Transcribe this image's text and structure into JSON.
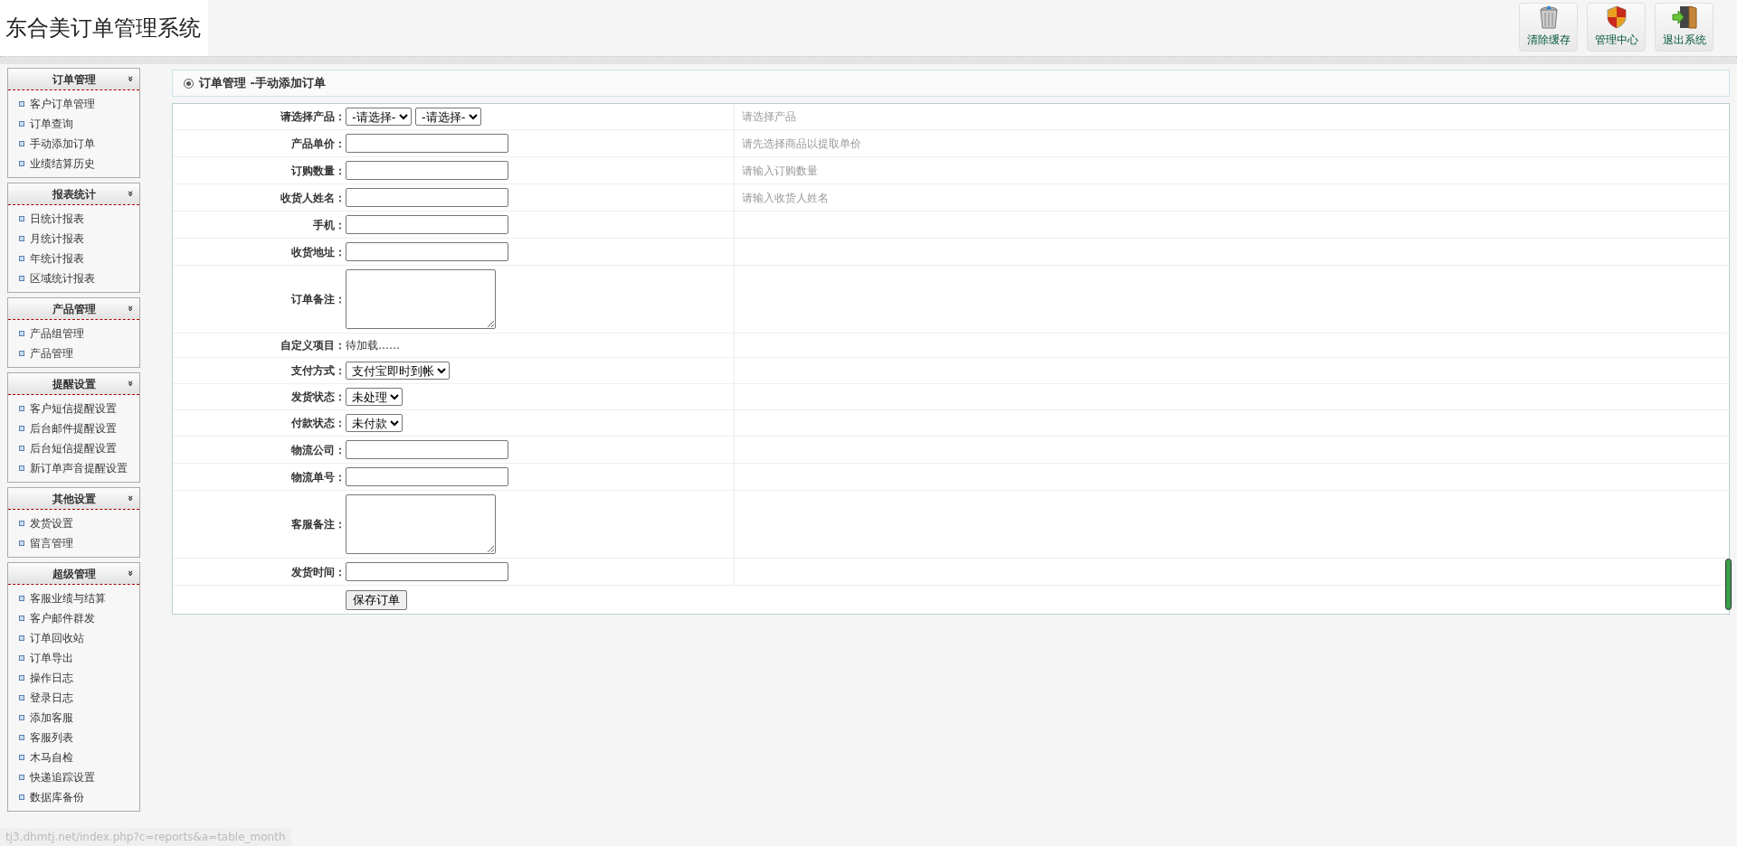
{
  "header": {
    "title": "东合美订单管理系统",
    "buttons": [
      {
        "kind": "trash",
        "label": "清除缓存"
      },
      {
        "kind": "shield",
        "label": "管理中心"
      },
      {
        "kind": "exit",
        "label": "退出系统"
      }
    ]
  },
  "sidebar": {
    "sections": [
      {
        "title": "订单管理",
        "toggle": "»",
        "items": [
          "客户订单管理",
          "订单查询",
          "手动添加订单",
          "业绩结算历史"
        ]
      },
      {
        "title": "报表统计",
        "toggle": "»",
        "items": [
          "日统计报表",
          "月统计报表",
          "年统计报表",
          "区域统计报表"
        ]
      },
      {
        "title": "产品管理",
        "toggle": "»",
        "items": [
          "产品组管理",
          "产品管理"
        ]
      },
      {
        "title": "提醒设置",
        "toggle": "»",
        "items": [
          "客户短信提醒设置",
          "后台邮件提醒设置",
          "后台短信提醒设置",
          "新订单声音提醒设置"
        ]
      },
      {
        "title": "其他设置",
        "toggle": "»",
        "items": [
          "发货设置",
          "留言管理"
        ]
      },
      {
        "title": "超级管理",
        "toggle": "»",
        "items": [
          "客服业绩与结算",
          "客户邮件群发",
          "订单回收站",
          "订单导出",
          "操作日志",
          "登录日志",
          "添加客服",
          "客服列表",
          "木马自检",
          "快递追踪设置",
          "数据库备份"
        ]
      }
    ]
  },
  "page_title": "订单管理 -手动添加订单",
  "form": {
    "rows": [
      {
        "label": "请选择产品：",
        "kind": "select",
        "values": [
          "-请选择-",
          "-请选择-"
        ],
        "hint": "请选择产品"
      },
      {
        "label": "产品单价：",
        "kind": "input",
        "hint": "请先选择商品以提取单价"
      },
      {
        "label": "订购数量：",
        "kind": "input",
        "hint": "请输入订购数量"
      },
      {
        "label": "收货人姓名：",
        "kind": "input",
        "hint": "请输入收货人姓名"
      },
      {
        "label": "手机：",
        "kind": "input"
      },
      {
        "label": "收货地址：",
        "kind": "input"
      },
      {
        "label": "订单备注：",
        "kind": "textarea"
      },
      {
        "label": "自定义项目：",
        "kind": "text",
        "text": "待加载……"
      },
      {
        "label": "支付方式：",
        "kind": "select",
        "values": [
          "支付宝即时到帐"
        ]
      },
      {
        "label": "发货状态：",
        "kind": "select",
        "values": [
          "未处理"
        ]
      },
      {
        "label": "付款状态：",
        "kind": "select",
        "values": [
          "未付款"
        ]
      },
      {
        "label": "物流公司：",
        "kind": "input"
      },
      {
        "label": "物流单号：",
        "kind": "input"
      },
      {
        "label": "客服备注：",
        "kind": "textarea"
      },
      {
        "label": "发货时间：",
        "kind": "input"
      }
    ],
    "submit": "保存订单"
  },
  "status_bar": {
    "text": "tj3.dhmtj.net/index.php?c=reports&a=table_month"
  }
}
